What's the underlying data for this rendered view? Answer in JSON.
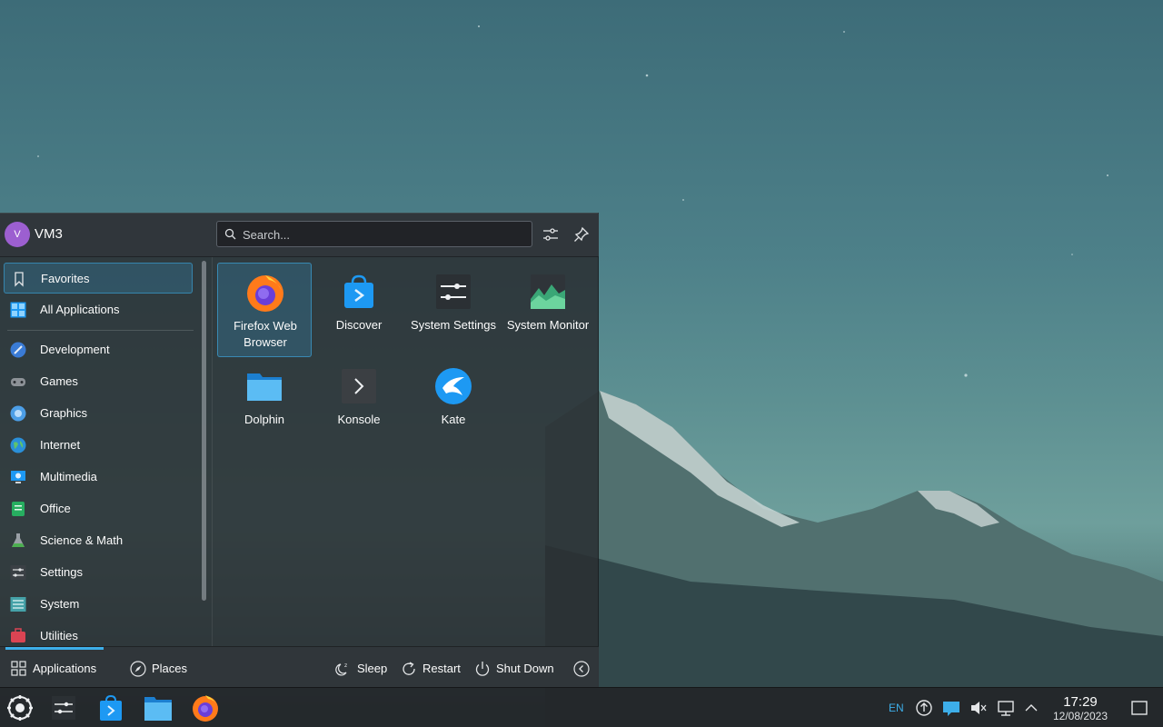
{
  "user": {
    "initial": "V",
    "name": "VM3"
  },
  "search": {
    "placeholder": "Search..."
  },
  "icons": {
    "search": "magnifier-icon",
    "configure": "sliders-icon",
    "pin": "pin-icon"
  },
  "sidebar": {
    "items": [
      {
        "label": "Favorites",
        "icon": "bookmark-icon",
        "active": true
      },
      {
        "label": "All Applications",
        "icon": "grid-icon"
      },
      {
        "label": "Development",
        "icon": "development-icon"
      },
      {
        "label": "Games",
        "icon": "gamepad-icon"
      },
      {
        "label": "Graphics",
        "icon": "graphics-icon"
      },
      {
        "label": "Internet",
        "icon": "globe-icon"
      },
      {
        "label": "Multimedia",
        "icon": "multimedia-icon"
      },
      {
        "label": "Office",
        "icon": "office-icon"
      },
      {
        "label": "Science & Math",
        "icon": "flask-icon"
      },
      {
        "label": "Settings",
        "icon": "settings-icon"
      },
      {
        "label": "System",
        "icon": "system-icon"
      },
      {
        "label": "Utilities",
        "icon": "toolbox-icon"
      }
    ]
  },
  "apps": [
    {
      "label": "Firefox Web Browser",
      "icon": "firefox-icon",
      "active": true
    },
    {
      "label": "Discover",
      "icon": "discover-icon"
    },
    {
      "label": "System Settings",
      "icon": "system-settings-icon"
    },
    {
      "label": "System Monitor",
      "icon": "system-monitor-icon"
    },
    {
      "label": "Dolphin",
      "icon": "folder-icon"
    },
    {
      "label": "Konsole",
      "icon": "terminal-icon"
    },
    {
      "label": "Kate",
      "icon": "kate-icon"
    }
  ],
  "footer": {
    "applications": "Applications",
    "places": "Places",
    "sleep": "Sleep",
    "restart": "Restart",
    "shutdown": "Shut Down"
  },
  "taskbar": {
    "apps": [
      "launcher-icon",
      "system-settings-icon",
      "discover-icon",
      "folder-icon",
      "firefox-icon"
    ],
    "tray": [
      "updates-icon",
      "notifications-icon",
      "volume-muted-icon",
      "network-icon",
      "chevron-up-icon"
    ],
    "lang": "EN",
    "time": "17:29",
    "date": "12/08/2023"
  },
  "colors": {
    "accent": "#3daee9",
    "panel": "#2a2e32",
    "avatar": "#9c5fd0"
  }
}
